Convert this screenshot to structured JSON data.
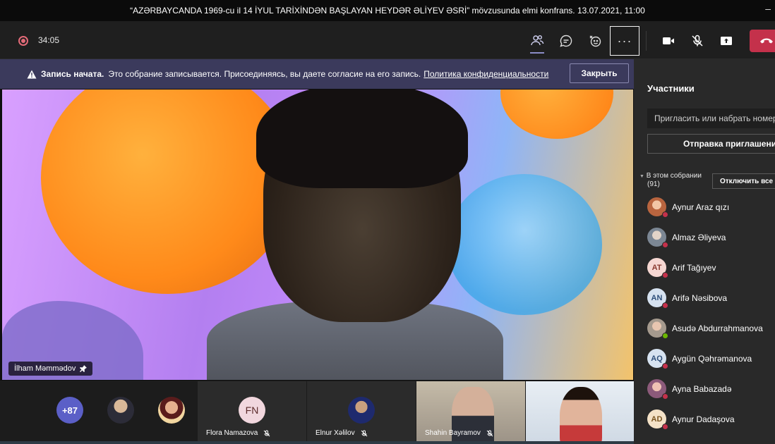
{
  "window": {
    "title": "“AZƏRBAYCANDA 1969-cu il 14 İYUL TARİXİNDƏN BAŞLAYAN HEYDƏR ƏLİYEV ƏSRİ” mövzusunda elmi konfrans. 13.07.2021, 11:00",
    "minimize_glyph": "–"
  },
  "toolbar": {
    "timer": "34:05",
    "more_label": "···"
  },
  "banner": {
    "bold": "Запись начата.",
    "text": "Это собрание записывается. Присоединяясь, вы даете согласие на его запись.",
    "link": "Политика конфиденциальности",
    "close": "Закрыть"
  },
  "main_video": {
    "name": "İlham Məmmədov"
  },
  "strip": {
    "overflow": "+87",
    "tiles": [
      {
        "name": "Flora Namazova",
        "initials": "FN"
      },
      {
        "name": "Elnur Xəlilov"
      },
      {
        "name": "Shahin Bayramov"
      }
    ]
  },
  "panel": {
    "title": "Участники",
    "invite_placeholder": "Пригласить или набрать номер",
    "share_invite": "Отправка приглашения",
    "section": "В этом собрании",
    "count": "(91)",
    "mute_all": "Отключить все",
    "participants": [
      {
        "name": "Aynur Araz qızı",
        "initials": "",
        "color": "#c97a4a",
        "status": "muted"
      },
      {
        "name": "Almaz Əliyeva",
        "initials": "",
        "color": "#8b96a3",
        "status": "muted"
      },
      {
        "name": "Arif Tağıyev",
        "initials": "AT",
        "color": "#f6d7d2",
        "text": "#8a3a30",
        "status": "muted"
      },
      {
        "name": "Arifə Nəsibova",
        "initials": "AN",
        "color": "#d6e2f0",
        "text": "#2f4f7a",
        "status": "muted"
      },
      {
        "name": "Asudə Abdurrahmanova",
        "initials": "",
        "color": "#a59a8e",
        "status": "available"
      },
      {
        "name": "Aygün Qəhrəmanova",
        "initials": "AQ",
        "color": "#d6e2f0",
        "text": "#2f4f7a",
        "status": "muted"
      },
      {
        "name": "Ayna Babazadə",
        "initials": "",
        "color": "#8c5a7a",
        "status": "muted"
      },
      {
        "name": "Aynur Dadaşova",
        "initials": "AD",
        "color": "#f4e2c7",
        "text": "#7a5520",
        "status": "muted"
      }
    ]
  },
  "colors": {
    "accent": "#5b5fc7",
    "leave": "#c4314b",
    "banner": "#3b3a5c"
  }
}
